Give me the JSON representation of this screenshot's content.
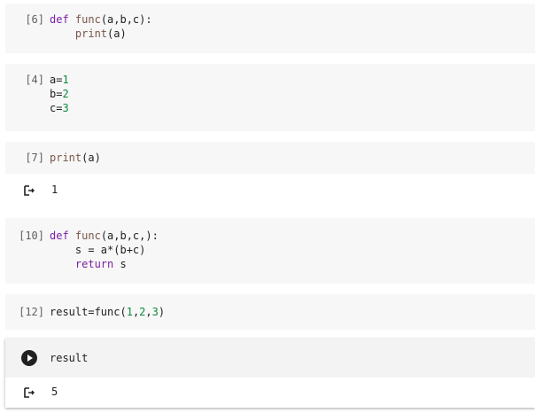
{
  "cells": [
    {
      "prompt": "[6]",
      "lines": [
        [
          {
            "t": "def ",
            "c": "kw"
          },
          {
            "t": "func",
            "c": "fn"
          },
          {
            "t": "(a,b,c):",
            "c": "op"
          }
        ],
        [
          {
            "t": "    ",
            "c": "op"
          },
          {
            "t": "print",
            "c": "fn"
          },
          {
            "t": "(a)",
            "c": "op"
          }
        ]
      ]
    },
    {
      "prompt": "[4]",
      "lines": [
        [
          {
            "t": "a=",
            "c": "op"
          },
          {
            "t": "1",
            "c": "num"
          }
        ],
        [
          {
            "t": "b=",
            "c": "op"
          },
          {
            "t": "2",
            "c": "num"
          }
        ],
        [
          {
            "t": "c=",
            "c": "op"
          },
          {
            "t": "3",
            "c": "num"
          }
        ]
      ]
    },
    {
      "prompt": "[7]",
      "lines": [
        [
          {
            "t": "print",
            "c": "fn"
          },
          {
            "t": "(a)",
            "c": "op"
          }
        ]
      ],
      "output": "1"
    },
    {
      "prompt": "[10]",
      "lines": [
        [
          {
            "t": "def ",
            "c": "kw"
          },
          {
            "t": "func",
            "c": "fn"
          },
          {
            "t": "(a,b,c,):",
            "c": "op"
          }
        ],
        [
          {
            "t": "    s = a*(b+c)",
            "c": "op"
          }
        ],
        [
          {
            "t": "    ",
            "c": "op"
          },
          {
            "t": "return",
            "c": "kw"
          },
          {
            "t": " s",
            "c": "op"
          }
        ]
      ]
    },
    {
      "prompt": "[12]",
      "lines": [
        [
          {
            "t": "result=func(",
            "c": "op"
          },
          {
            "t": "1",
            "c": "num"
          },
          {
            "t": ",",
            "c": "op"
          },
          {
            "t": "2",
            "c": "num"
          },
          {
            "t": ",",
            "c": "op"
          },
          {
            "t": "3",
            "c": "num"
          },
          {
            "t": ")",
            "c": "op"
          }
        ]
      ]
    }
  ],
  "active_cell": {
    "code": "result",
    "output": "5"
  },
  "icons": {
    "output": "output-arrow-icon",
    "run": "play-icon"
  },
  "colors": {
    "keyword": "#7b1fa2",
    "function": "#795548",
    "number": "#0a8a3a",
    "cell_bg": "#f7f7f7"
  }
}
